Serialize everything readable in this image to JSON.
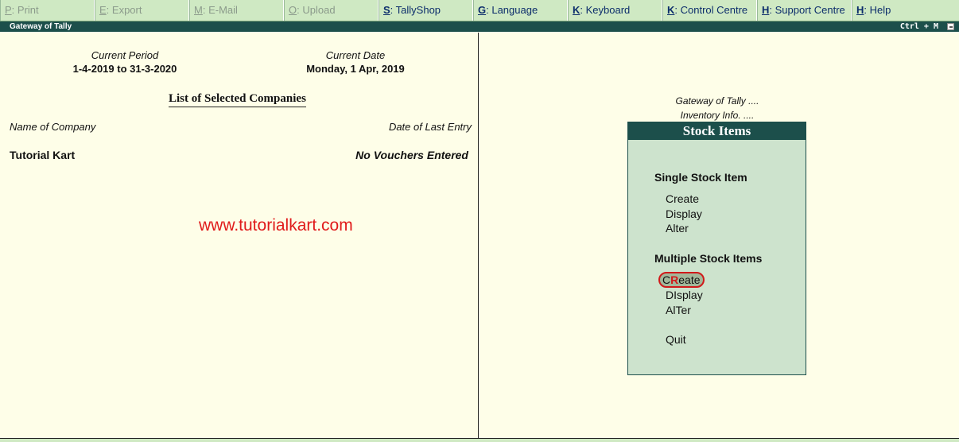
{
  "menubar": [
    {
      "key": "P",
      "label": ": Print",
      "enabled": false
    },
    {
      "key": "E",
      "label": ": Export",
      "enabled": false
    },
    {
      "key": "M",
      "label": ": E-Mail",
      "enabled": false
    },
    {
      "key": "O",
      "label": ": Upload",
      "enabled": false
    },
    {
      "key": "S",
      "label": ": TallyShop",
      "enabled": true
    },
    {
      "key": "G",
      "label": ": Language",
      "enabled": true
    },
    {
      "key": "K",
      "label": ": Keyboard",
      "enabled": true
    },
    {
      "key": "K",
      "label": ": Control Centre",
      "enabled": true
    },
    {
      "key": "H",
      "label": ": Support Centre",
      "enabled": true
    },
    {
      "key": "H",
      "label": ": Help",
      "enabled": true
    }
  ],
  "titlebar": {
    "title": "Gateway of Tally",
    "shortcut": "Ctrl + M"
  },
  "period": {
    "label": "Current Period",
    "value": "1-4-2019 to 31-3-2020"
  },
  "date": {
    "label": "Current Date",
    "value": "Monday, 1 Apr, 2019"
  },
  "companies": {
    "heading": "List of Selected Companies",
    "col_name": "Name of Company",
    "col_last": "Date of Last Entry",
    "rows": [
      {
        "name": "Tutorial Kart",
        "last_entry": "No Vouchers Entered"
      }
    ]
  },
  "watermark": "www.tutorialkart.com",
  "breadcrumb": [
    "Gateway of Tally ....",
    "Inventory Info. ...."
  ],
  "stock": {
    "title": "Stock Items",
    "single_heading": "Single Stock Item",
    "single_options": [
      "Create",
      "Display",
      "Alter"
    ],
    "multiple_heading": "Multiple Stock Items",
    "multiple_options": [
      {
        "pre": "C",
        "hot": "R",
        "post": "eate",
        "selected": true
      },
      {
        "pre": "D",
        "hot": "I",
        "post": "splay",
        "selected": false
      },
      {
        "pre": "Al",
        "hot": "T",
        "post": "er",
        "selected": false
      }
    ],
    "quit": "Quit"
  },
  "colors": {
    "accent": "#1c4f4b",
    "menubar": "#cfe9c3",
    "panel": "#cde3cd",
    "highlight": "#d11a1a"
  }
}
